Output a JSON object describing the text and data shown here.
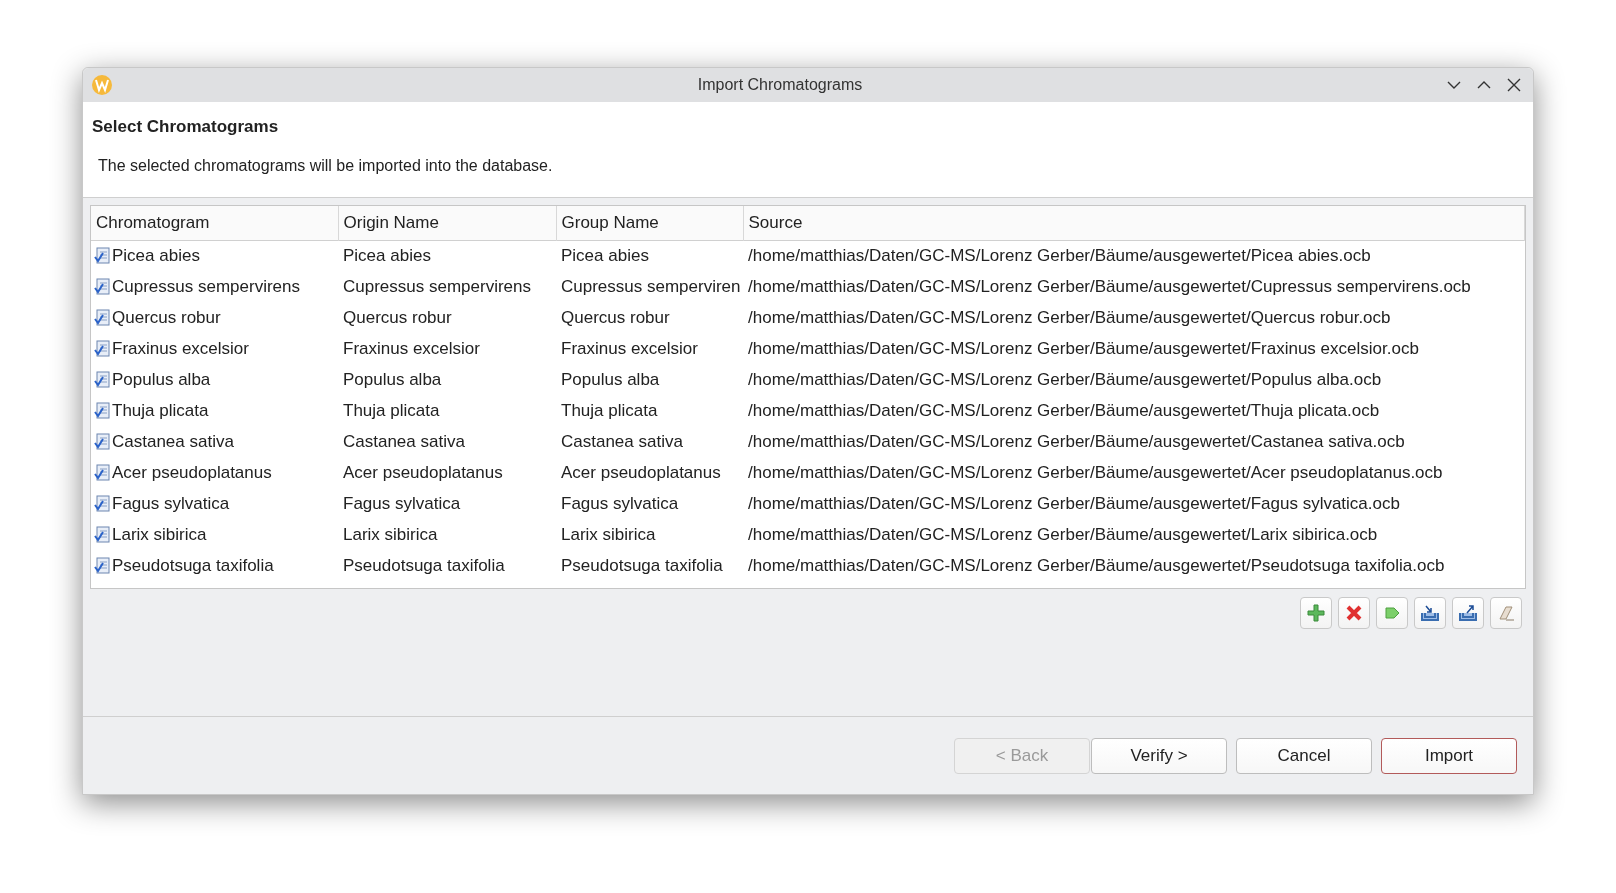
{
  "window": {
    "title": "Import Chromatograms"
  },
  "page": {
    "title": "Select Chromatograms",
    "description": "The selected chromatograms will be imported into the database."
  },
  "table": {
    "columns": [
      "Chromatogram",
      "Origin Name",
      "Group Name",
      "Source"
    ],
    "rows": [
      {
        "chromatogram": "Picea abies",
        "origin": "Picea abies",
        "group": "Picea abies",
        "source": "/home/matthias/Daten/GC-MS/Lorenz Gerber/Bäume/ausgewertet/Picea abies.ocb"
      },
      {
        "chromatogram": "Cupressus sempervirens",
        "origin": "Cupressus sempervirens",
        "group": "Cupressus semperviren",
        "source": "/home/matthias/Daten/GC-MS/Lorenz Gerber/Bäume/ausgewertet/Cupressus sempervirens.ocb"
      },
      {
        "chromatogram": "Quercus robur",
        "origin": "Quercus robur",
        "group": "Quercus robur",
        "source": "/home/matthias/Daten/GC-MS/Lorenz Gerber/Bäume/ausgewertet/Quercus robur.ocb"
      },
      {
        "chromatogram": "Fraxinus excelsior",
        "origin": "Fraxinus excelsior",
        "group": "Fraxinus excelsior",
        "source": "/home/matthias/Daten/GC-MS/Lorenz Gerber/Bäume/ausgewertet/Fraxinus excelsior.ocb"
      },
      {
        "chromatogram": "Populus alba",
        "origin": "Populus alba",
        "group": "Populus alba",
        "source": "/home/matthias/Daten/GC-MS/Lorenz Gerber/Bäume/ausgewertet/Populus alba.ocb"
      },
      {
        "chromatogram": "Thuja plicata",
        "origin": "Thuja plicata",
        "group": "Thuja plicata",
        "source": "/home/matthias/Daten/GC-MS/Lorenz Gerber/Bäume/ausgewertet/Thuja plicata.ocb"
      },
      {
        "chromatogram": "Castanea sativa",
        "origin": "Castanea sativa",
        "group": "Castanea sativa",
        "source": "/home/matthias/Daten/GC-MS/Lorenz Gerber/Bäume/ausgewertet/Castanea sativa.ocb"
      },
      {
        "chromatogram": "Acer pseudoplatanus",
        "origin": "Acer pseudoplatanus",
        "group": "Acer pseudoplatanus",
        "source": "/home/matthias/Daten/GC-MS/Lorenz Gerber/Bäume/ausgewertet/Acer pseudoplatanus.ocb"
      },
      {
        "chromatogram": "Fagus sylvatica",
        "origin": "Fagus sylvatica",
        "group": "Fagus sylvatica",
        "source": "/home/matthias/Daten/GC-MS/Lorenz Gerber/Bäume/ausgewertet/Fagus sylvatica.ocb"
      },
      {
        "chromatogram": "Larix sibirica",
        "origin": "Larix sibirica",
        "group": "Larix sibirica",
        "source": "/home/matthias/Daten/GC-MS/Lorenz Gerber/Bäume/ausgewertet/Larix sibirica.ocb"
      },
      {
        "chromatogram": "Pseudotsuga taxifolia",
        "origin": "Pseudotsuga taxifolia",
        "group": "Pseudotsuga taxifolia",
        "source": "/home/matthias/Daten/GC-MS/Lorenz Gerber/Bäume/ausgewertet/Pseudotsuga taxifolia.ocb"
      }
    ]
  },
  "toolbar": [
    {
      "kind": "add"
    },
    {
      "kind": "remove"
    },
    {
      "kind": "tag"
    },
    {
      "kind": "import"
    },
    {
      "kind": "export"
    },
    {
      "kind": "clear"
    }
  ],
  "buttons": [
    {
      "label": "< Back",
      "disabled": true,
      "default": false
    },
    {
      "label": "Verify >",
      "disabled": false,
      "default": false
    },
    {
      "label": "Cancel",
      "disabled": false,
      "default": false
    },
    {
      "label": "Import",
      "disabled": false,
      "default": true
    }
  ]
}
